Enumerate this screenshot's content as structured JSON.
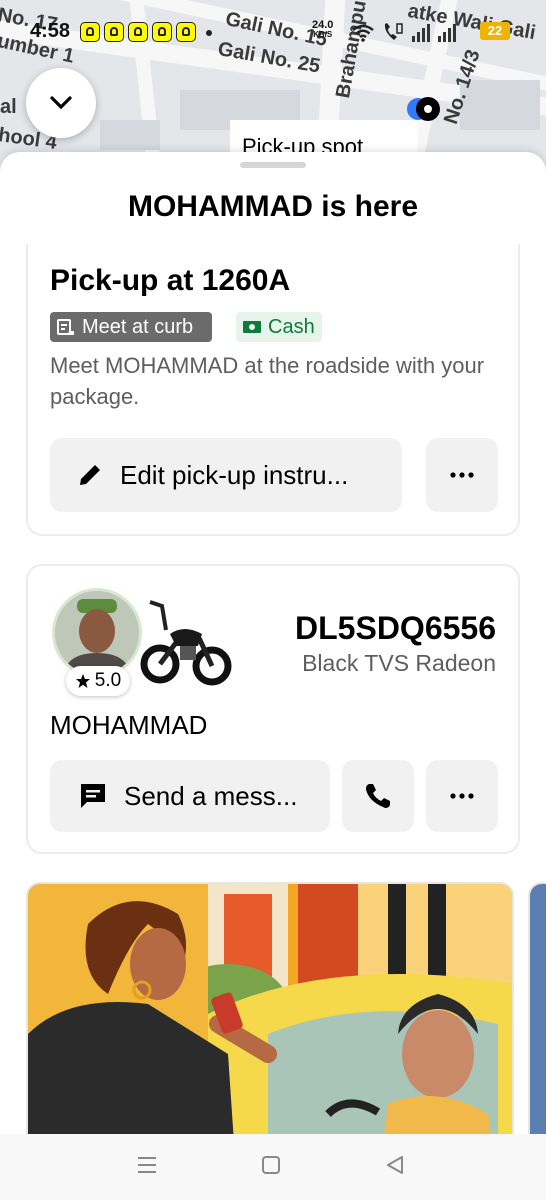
{
  "status_bar": {
    "time": "4:58",
    "net_speed": "24.0",
    "net_unit": "KB/S",
    "battery": "22",
    "icons": [
      "snapchat-icon",
      "wifi-icon",
      "call-icon",
      "signal-icon"
    ]
  },
  "map": {
    "labels": [
      "No. 17",
      "Gali No. 15",
      "Gali No. 25",
      "Brahampuri",
      "atke Wali Gali",
      "No. 14/3",
      "umber 1",
      "hool 4",
      "al"
    ],
    "pickup_tag": "Pick-up spot"
  },
  "sheet": {
    "title": "MOHAMMAD is here"
  },
  "pickup_card": {
    "title": "Pick-up at 1260A",
    "badge_curb": "Meet at curb",
    "badge_cash": "Cash",
    "description": "Meet MOHAMMAD at the roadside with your package.",
    "edit_button": "Edit pick-up instru...",
    "more_label": "•••"
  },
  "driver_card": {
    "rating": "5.0",
    "plate": "DL5SDQ6556",
    "vehicle": "Black TVS Radeon",
    "driver_name": "MOHAMMAD",
    "message_button": "Send a mess...",
    "more_label": "•••"
  },
  "colors": {
    "accent_green": "#0e7a3c",
    "badge_gray": "#6b6b6b",
    "button_bg": "#f1f1f1",
    "location_blue": "#2f7bf5"
  }
}
